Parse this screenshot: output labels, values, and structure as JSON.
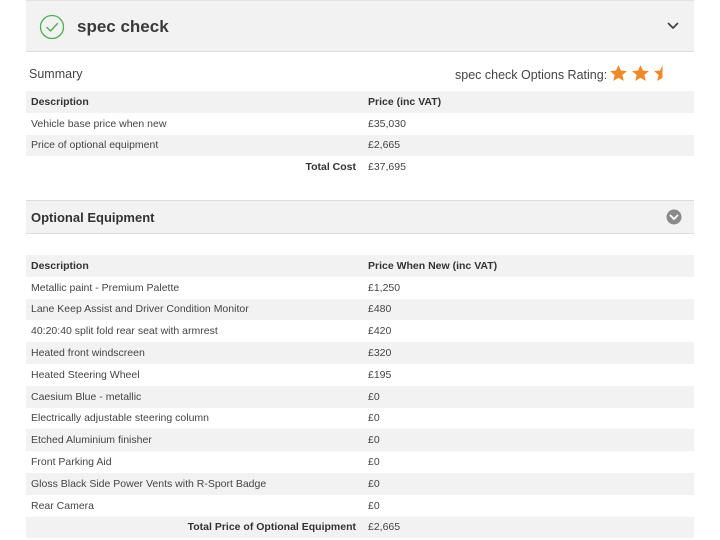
{
  "header": {
    "title": "spec check"
  },
  "summary": {
    "label": "Summary",
    "rating_label": "spec check Options Rating:",
    "rating_value": 2.5,
    "rating_max": 3,
    "columns": [
      "Description",
      "Price (inc VAT)"
    ],
    "rows": [
      {
        "description": "Vehicle base price when new",
        "price": "£35,030"
      },
      {
        "description": "Price of optional equipment",
        "price": "£2,665"
      }
    ],
    "total_label": "Total Cost",
    "total_value": "£37,695"
  },
  "optional": {
    "title": "Optional Equipment",
    "columns": [
      "Description",
      "Price When New (inc VAT)"
    ],
    "rows": [
      {
        "description": "Metallic paint - Premium Palette",
        "price": "£1,250"
      },
      {
        "description": "Lane Keep Assist and Driver Condition Monitor",
        "price": "£480"
      },
      {
        "description": "40:20:40 split fold rear seat with armrest",
        "price": "£420"
      },
      {
        "description": "Heated front windscreen",
        "price": "£320"
      },
      {
        "description": "Heated Steering Wheel",
        "price": "£195"
      },
      {
        "description": "Caesium Blue - metallic",
        "price": "£0"
      },
      {
        "description": "Electrically adjustable steering column",
        "price": "£0"
      },
      {
        "description": "Etched Aluminium finisher",
        "price": "£0"
      },
      {
        "description": "Front Parking Aid",
        "price": "£0"
      },
      {
        "description": "Gloss Black Side Power Vents with R-Sport Badge",
        "price": "£0"
      },
      {
        "description": "Rear Camera",
        "price": "£0"
      }
    ],
    "total_label": "Total Price of Optional Equipment",
    "total_value": "£2,665"
  },
  "colors": {
    "accent_green": "#4caf50",
    "star_orange": "#f0892a",
    "header_bg": "#f2f2f2"
  },
  "icons": {
    "header_icon": "check-circle-icon",
    "collapse_icon": "chevron-down-icon",
    "section_toggle_icon": "chevron-down-circle-icon",
    "rating_icon": "star-icon"
  }
}
